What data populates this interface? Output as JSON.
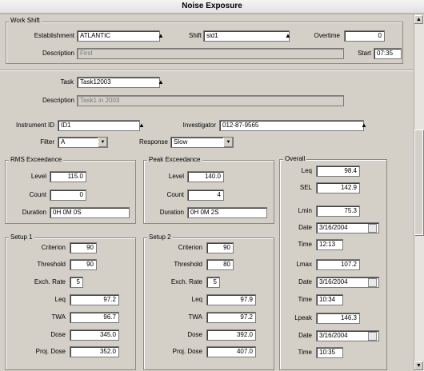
{
  "window": {
    "title": "Noise Exposure"
  },
  "work_shift": {
    "legend": "Work Shift",
    "establishment_label": "Establishment",
    "establishment": "ATLANTIC",
    "shift_label": "Shift",
    "shift": "sid1",
    "overtime_label": "Overtime",
    "overtime": "0",
    "description_label": "Description",
    "description": "First",
    "start_label": "Start",
    "start": "07:35"
  },
  "task": {
    "task_label": "Task",
    "task": "Task12003",
    "description_label": "Description",
    "description": "Task1 in 2003"
  },
  "instrument": {
    "instrument_label": "Instrument ID",
    "instrument": "ID1",
    "investigator_label": "Investigator",
    "investigator": "012-87-9565",
    "filter_label": "Filter",
    "filter": "A",
    "response_label": "Response",
    "response": "Slow"
  },
  "rms": {
    "legend": "RMS Exceedance",
    "level_label": "Level",
    "level": "115.0",
    "count_label": "Count",
    "count": "0",
    "duration_label": "Duration",
    "duration": "0H 0M 0S"
  },
  "peak": {
    "legend": "Peak Exceedance",
    "level_label": "Level",
    "level": "140.0",
    "count_label": "Count",
    "count": "4",
    "duration_label": "Duration",
    "duration": "0H 0M 2S"
  },
  "setup1": {
    "legend": "Setup 1",
    "criterion_label": "Criterion",
    "criterion": "90",
    "threshold_label": "Threshold",
    "threshold": "90",
    "exch_label": "Exch. Rate",
    "exch": "5",
    "leq_label": "Leq",
    "leq": "97.2",
    "twa_label": "TWA",
    "twa": "96.7",
    "dose_label": "Dose",
    "dose": "345.0",
    "proj_label": "Proj. Dose",
    "proj": "352.0"
  },
  "setup2": {
    "legend": "Setup 2",
    "criterion_label": "Criterion",
    "criterion": "90",
    "threshold_label": "Threshold",
    "threshold": "80",
    "exch_label": "Exch. Rate",
    "exch": "5",
    "leq_label": "Leq",
    "leq": "97.9",
    "twa_label": "TWA",
    "twa": "97.2",
    "dose_label": "Dose",
    "dose": "392.0",
    "proj_label": "Proj. Dose",
    "proj": "407.0"
  },
  "overall": {
    "legend": "Overall",
    "leq_label": "Leq",
    "leq": "98.4",
    "sel_label": "SEL",
    "sel": "142.9",
    "lmin_label": "Lmin",
    "lmin": "75.3",
    "date1_label": "Date",
    "date1": "3/16/2004",
    "time1_label": "Time",
    "time1": "12:13",
    "lmax_label": "Lmax",
    "lmax": "107.2",
    "date2_label": "Date",
    "date2": "3/16/2004",
    "time2_label": "Time",
    "time2": "10:34",
    "lpeak_label": "Lpeak",
    "lpeak": "146.3",
    "date3_label": "Date",
    "date3": "3/16/2004",
    "time3_label": "Time",
    "time3": "10:35"
  },
  "icons": {
    "lookup": "binoculars-icon",
    "calendar": "calendar-icon",
    "dropdown": "triangle-down-icon"
  }
}
